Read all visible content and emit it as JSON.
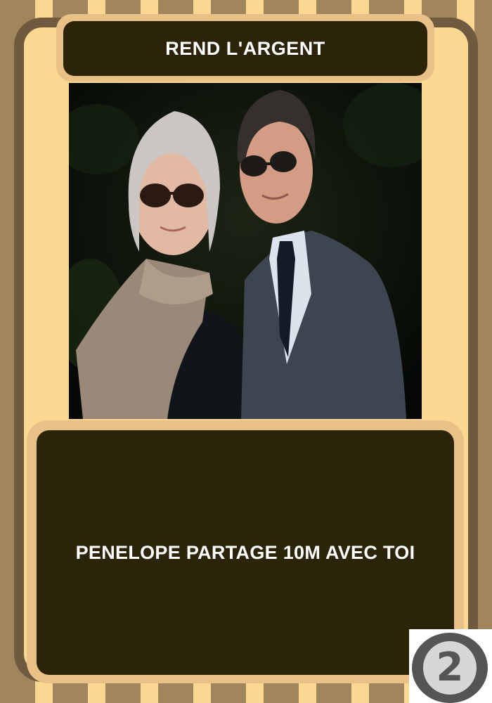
{
  "card": {
    "title": "REND L'ARGENT",
    "text": "PENELOPE PARTAGE 10M AVEC TOI",
    "number": "2"
  },
  "colors": {
    "background": "#fbd891",
    "stripe": "#a1855d",
    "frame": "#6f5a3f",
    "panel_border": "#e9c186",
    "panel": "#2b2409",
    "text": "#ffffff"
  },
  "image": {
    "description_icon": "photo-of-couple"
  }
}
